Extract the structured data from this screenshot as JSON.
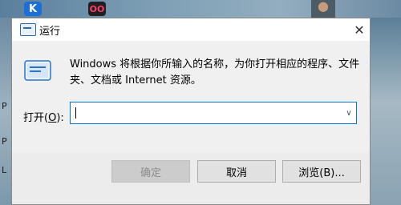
{
  "desktop": {
    "icons": [
      {
        "name": "K",
        "label": "K"
      },
      {
        "name": "OO",
        "label": "OO"
      }
    ],
    "left_edge_letters": [
      "P",
      "P",
      "L"
    ]
  },
  "dialog": {
    "title": "运行",
    "description": "Windows 将根据你所输入的名称，为你打开相应的程序、文件夹、文档或 Internet 资源。",
    "open_label_prefix": "打开(",
    "open_label_key": "O",
    "open_label_suffix": "):",
    "input_value": "",
    "buttons": {
      "ok": "确定",
      "cancel": "取消",
      "browse": "浏览(B)..."
    }
  }
}
